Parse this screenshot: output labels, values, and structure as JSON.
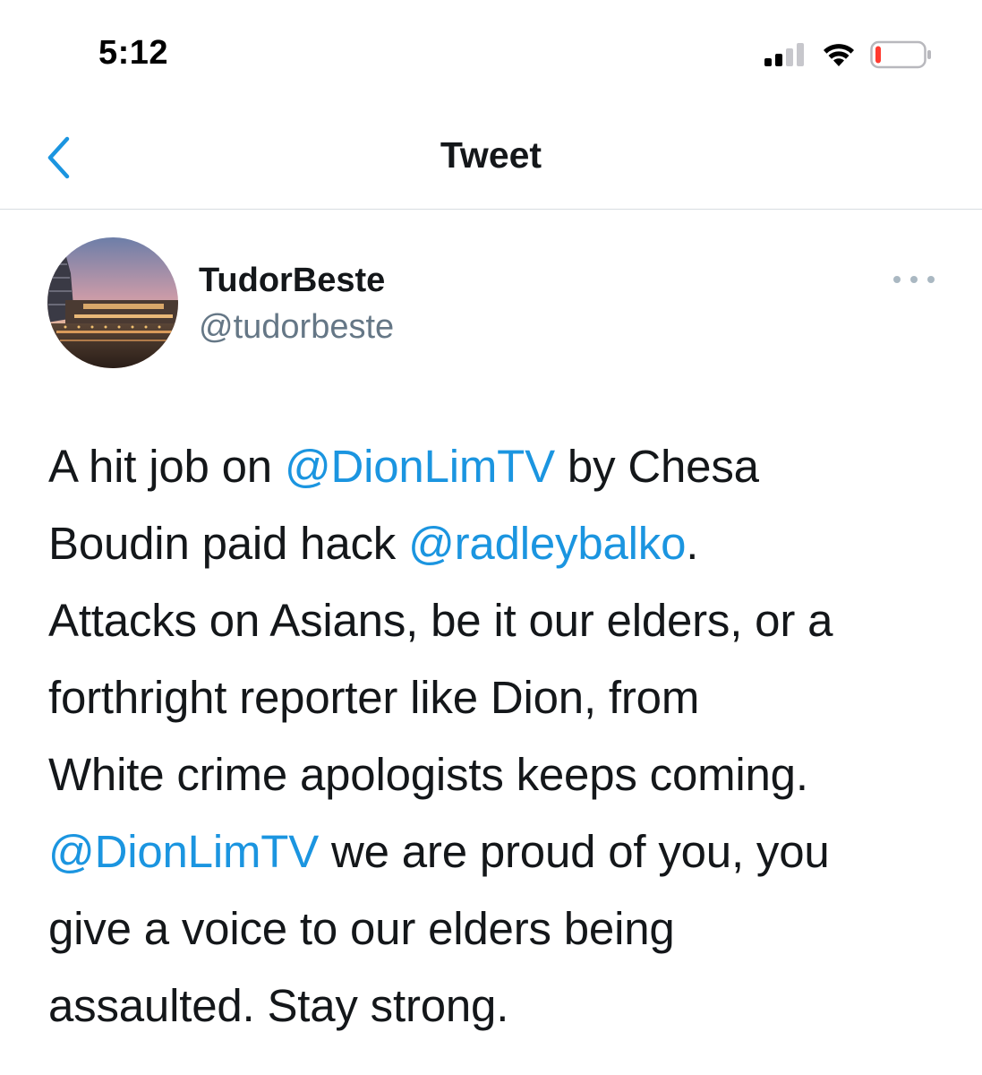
{
  "status_bar": {
    "time": "5:12",
    "icons": [
      "signal-icon",
      "wifi-icon",
      "battery-icon"
    ],
    "battery_level": 0.12,
    "battery_color": "#ff3b30"
  },
  "nav": {
    "back_icon": "chevron-left-icon",
    "title": "Tweet"
  },
  "tweet": {
    "display_name": "TudorBeste",
    "handle": "@tudorbeste",
    "more_icon": "more-horizontal-icon",
    "lines": [
      {
        "t1": "A hit job on ",
        "m1": "@DionLimTV",
        "t2": " by Chesa"
      },
      {
        "t1": "Boudin paid hack ",
        "m1": "@radleybalko",
        "t2": "."
      },
      {
        "t1": "Attacks on Asians, be it our elders, or a"
      },
      {
        "t1": "forthright reporter like Dion, from"
      },
      {
        "t1": "White crime apologists keeps coming."
      },
      {
        "m1": "@DionLimTV",
        "t2": " we are proud of you, you"
      },
      {
        "t1": "give a voice to our elders being"
      },
      {
        "t1": "assaulted. Stay strong."
      }
    ]
  },
  "colors": {
    "text": "#14171a",
    "secondary_text": "#657786",
    "link": "#1b95e0",
    "divider": "#d8dde1"
  }
}
